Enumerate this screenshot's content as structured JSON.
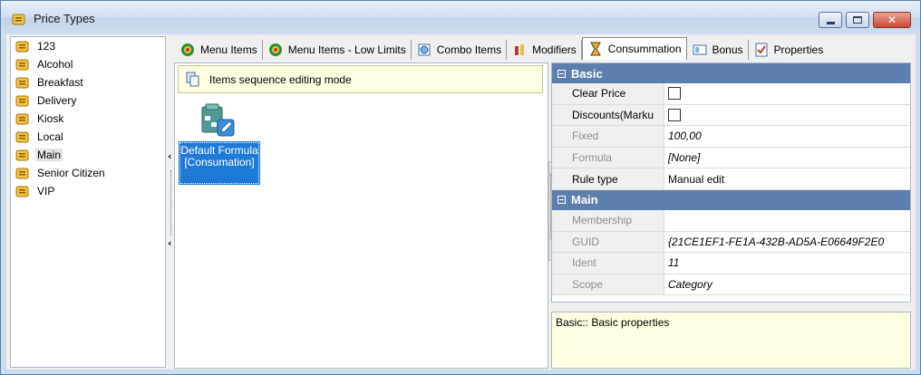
{
  "window": {
    "title": "Price Types",
    "buttons": {
      "minimize": "minimize",
      "maximize": "maximize",
      "close": "close"
    }
  },
  "price_types": [
    {
      "label": "123",
      "selected": false
    },
    {
      "label": "Alcohol",
      "selected": false
    },
    {
      "label": "Breakfast",
      "selected": false
    },
    {
      "label": "Delivery",
      "selected": false
    },
    {
      "label": "Kiosk",
      "selected": false
    },
    {
      "label": "Local",
      "selected": false
    },
    {
      "label": "Main",
      "selected": true
    },
    {
      "label": "Senior Citizen",
      "selected": false
    },
    {
      "label": "VIP",
      "selected": false
    }
  ],
  "tabs": [
    {
      "label": "Menu Items",
      "icon": "menu-items-icon",
      "active": false
    },
    {
      "label": "Menu Items - Low Limits",
      "icon": "low-limits-icon",
      "active": false
    },
    {
      "label": "Combo Items",
      "icon": "combo-items-icon",
      "active": false
    },
    {
      "label": "Modifiers",
      "icon": "modifiers-icon",
      "active": false
    },
    {
      "label": "Consummation",
      "icon": "hourglass-icon",
      "active": true
    },
    {
      "label": "Bonus",
      "icon": "bonus-icon",
      "active": false
    },
    {
      "label": "Properties",
      "icon": "properties-icon",
      "active": false
    }
  ],
  "editor": {
    "mode_text": "Items sequence editing mode",
    "formula_label": "Default Formula [Consumation]"
  },
  "properties": {
    "categories": [
      {
        "name": "Basic",
        "rows": [
          {
            "name": "Clear Price",
            "value": "",
            "type": "checkbox",
            "checked": false,
            "disabled": false
          },
          {
            "name": "Discounts(Marku",
            "value": "",
            "type": "checkbox",
            "checked": false,
            "disabled": false
          },
          {
            "name": "Fixed",
            "value": "100,00",
            "type": "text",
            "disabled": true,
            "italic": true
          },
          {
            "name": "Formula",
            "value": "[None]",
            "type": "text",
            "disabled": true,
            "italic": true
          },
          {
            "name": "Rule type",
            "value": "Manual edit",
            "type": "text",
            "disabled": false,
            "italic": false
          }
        ]
      },
      {
        "name": "Main",
        "rows": [
          {
            "name": "Membership",
            "value": "",
            "type": "text",
            "disabled": true,
            "italic": true
          },
          {
            "name": "GUID",
            "value": "{21CE1EF1-FE1A-432B-AD5A-E06649F2E0",
            "type": "text",
            "disabled": true,
            "italic": true
          },
          {
            "name": "Ident",
            "value": "11",
            "type": "text",
            "disabled": true,
            "italic": true
          },
          {
            "name": "Scope",
            "value": "Category",
            "type": "text",
            "disabled": true,
            "italic": true
          }
        ]
      }
    ],
    "description": "Basic:: Basic properties"
  },
  "colors": {
    "category_header": "#5d7fae",
    "selection": "#1f7ad6",
    "mode_bar": "#fffde2",
    "description_bg": "#ffffe3"
  }
}
